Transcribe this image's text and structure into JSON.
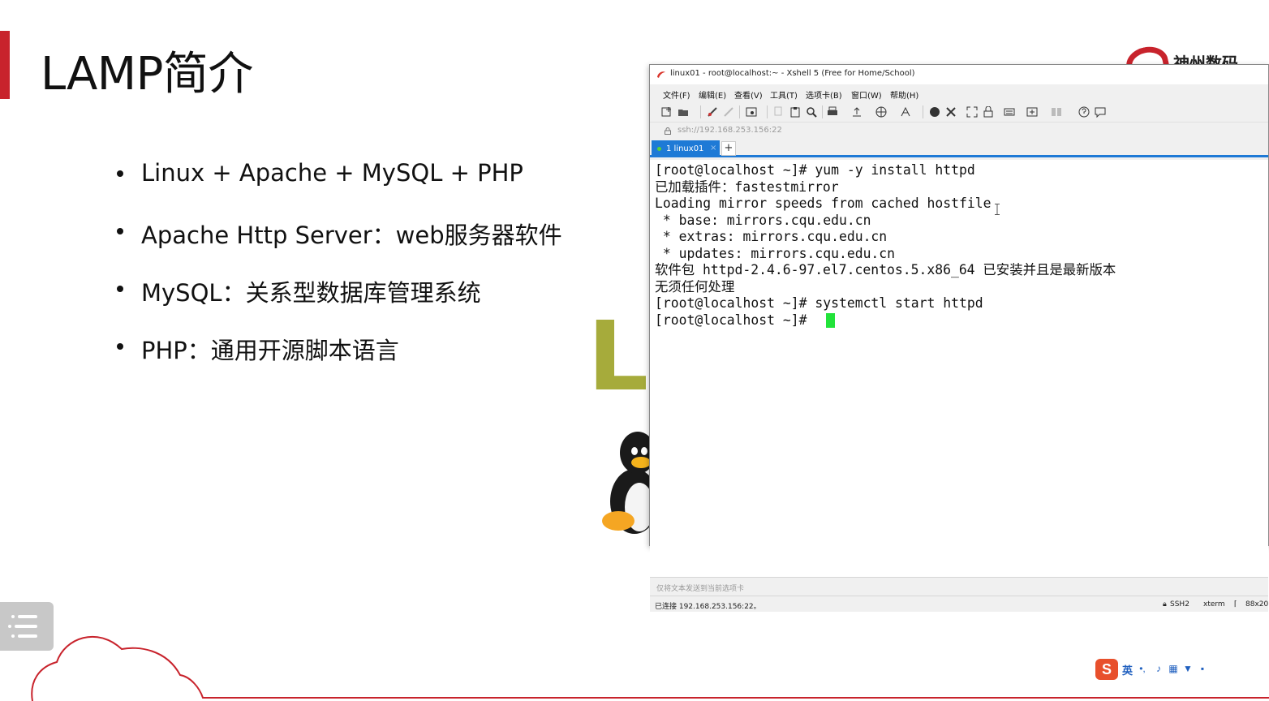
{
  "slide": {
    "title": "LAMP简介",
    "bullets": [
      "Linux + Apache + MySQL + PHP",
      "Apache Http Server：web服务器软件",
      "MySQL：关系型数据库管理系统",
      "PHP：通用开源脚本语言"
    ],
    "brand_text": "神州数码",
    "linux_logo_text": "Li",
    "accent_color": "#c8232c"
  },
  "xshell": {
    "title": "linux01 - root@localhost:~ - Xshell 5 (Free for Home/School)",
    "menu": [
      "文件(F)",
      "编辑(E)",
      "查看(V)",
      "工具(T)",
      "选项卡(B)",
      "窗口(W)",
      "帮助(H)"
    ],
    "address": "ssh://192.168.253.156:22",
    "tab_label": "1 linux01",
    "tab_close": "×",
    "tab_add": "+",
    "terminal_lines": [
      "[root@localhost ~]# yum -y install httpd",
      "已加载插件：fastestmirror",
      "Loading mirror speeds from cached hostfile",
      " * base: mirrors.cqu.edu.cn",
      " * extras: mirrors.cqu.edu.cn",
      " * updates: mirrors.cqu.edu.cn",
      "软件包 httpd-2.4.6-97.el7.centos.5.x86_64 已安装并且是最新版本",
      "无须任何处理",
      "[root@localhost ~]# systemctl start httpd",
      "[root@localhost ~]# "
    ],
    "compose_placeholder": "仅将文本发送到当前选项卡",
    "status": {
      "connection": "已连接 192.168.253.156:22。",
      "protocol": "SSH2",
      "terminal_type": "xterm",
      "size": "88x20"
    },
    "tab_color": "#1e7ad6",
    "cursor_color": "#22e33a"
  },
  "ime": {
    "language": "英"
  }
}
